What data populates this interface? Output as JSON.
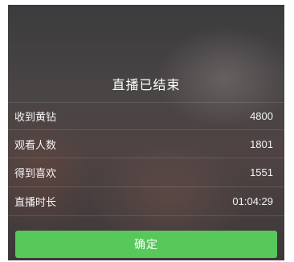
{
  "dialog": {
    "title": "直播已结束",
    "stats": [
      {
        "label": "收到黄钻",
        "value": "4800"
      },
      {
        "label": "观看人数",
        "value": "1801"
      },
      {
        "label": "得到喜欢",
        "value": "1551"
      },
      {
        "label": "直播时长",
        "value": "01:04:29"
      }
    ],
    "confirm_label": "确定"
  },
  "colors": {
    "confirm_button": "#57c85a",
    "text": "#ffffff"
  }
}
